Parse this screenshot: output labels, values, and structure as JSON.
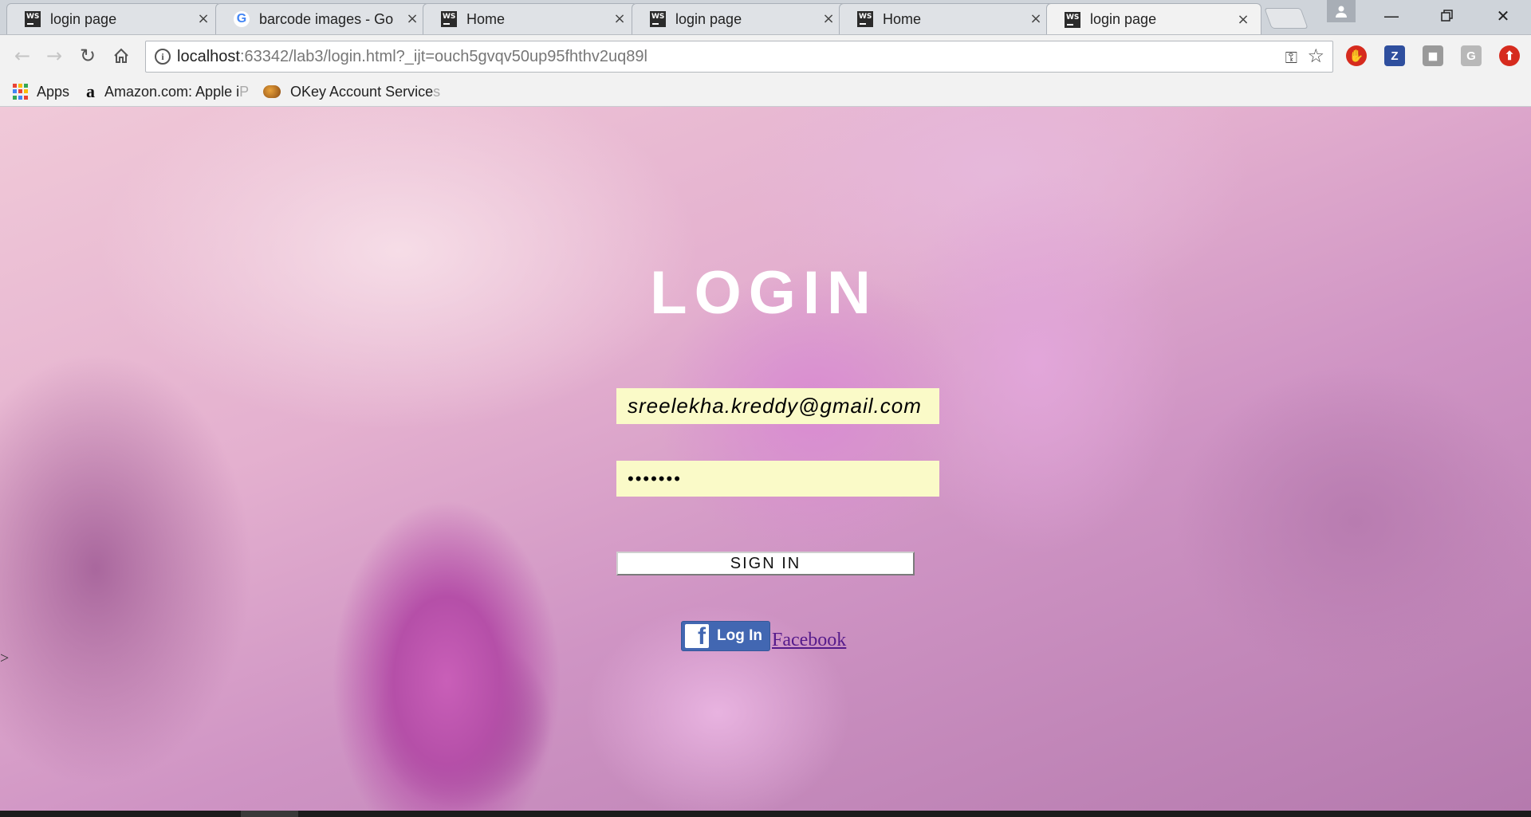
{
  "browser": {
    "tabs": [
      {
        "title": "login page",
        "icon": "webstorm-icon",
        "active": false
      },
      {
        "title": "barcode images - Go",
        "icon": "google-icon",
        "active": false
      },
      {
        "title": "Home",
        "icon": "webstorm-icon",
        "active": false
      },
      {
        "title": "login page",
        "icon": "webstorm-icon",
        "active": false
      },
      {
        "title": "Home",
        "icon": "webstorm-icon",
        "active": false
      },
      {
        "title": "login page",
        "icon": "webstorm-icon",
        "active": true
      }
    ],
    "favicon_text": "WS",
    "google_glyph": "G",
    "url_host": "localhost",
    "url_rest": ":63342/lab3/login.html?_ijt=ouch5gvqv50up95fhthv2uq89l",
    "bookmarks": {
      "apps": "Apps",
      "amazon": "Amazon.com: Apple i",
      "amazon_fade": "P",
      "okey": "OKey Account Service",
      "okey_fade": "s"
    },
    "extensions": [
      "adblock-icon",
      "zotero-icon",
      "ghostery-icon",
      "google-ext-icon",
      "update-icon"
    ],
    "extension_labels": {
      "zotero": "Z",
      "google_ext": "G"
    }
  },
  "login": {
    "title": "LOGIN",
    "email_value": "sreelekha.kreddy@gmail.com",
    "password_value": "•••••••",
    "signin_label": "SIGN IN",
    "fb_login_label": "Log In",
    "fb_glyph": "f",
    "facebook_link": "Facebook",
    "stray_text": ">"
  },
  "colors": {
    "input_background": "#fafac8",
    "facebook_blue": "#4267b2",
    "visited_link": "#551a8b"
  }
}
